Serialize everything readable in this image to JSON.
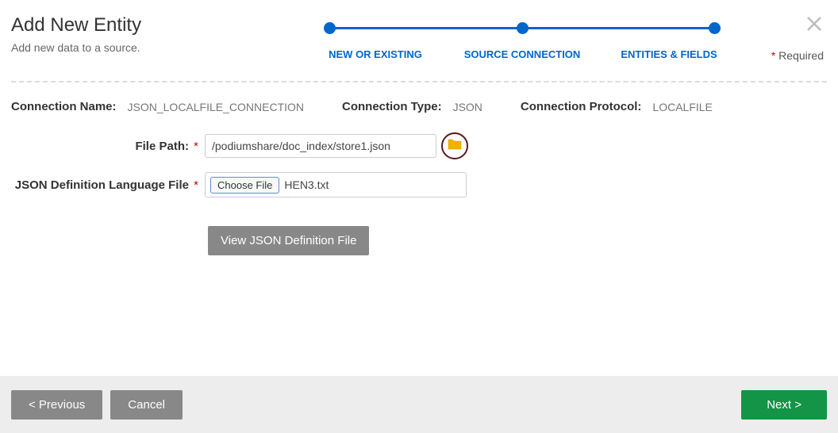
{
  "header": {
    "title": "Add New Entity",
    "subtitle": "Add new data to a source.",
    "required_label": "Required"
  },
  "steps": {
    "s1": "NEW OR EXISTING",
    "s2": "SOURCE CONNECTION",
    "s3": "ENTITIES & FIELDS"
  },
  "connection": {
    "name_label": "Connection Name:",
    "name_value": "JSON_LOCALFILE_CONNECTION",
    "type_label": "Connection Type:",
    "type_value": "JSON",
    "protocol_label": "Connection Protocol:",
    "protocol_value": "LOCALFILE"
  },
  "form": {
    "file_path_label": "File Path:",
    "file_path_value": "/podiumshare/doc_index/store1.json",
    "json_def_label": "JSON Definition Language File",
    "choose_file_label": "Choose File",
    "chosen_file_name": "HEN3.txt",
    "view_btn": "View JSON Definition File"
  },
  "footer": {
    "previous": "< Previous",
    "cancel": "Cancel",
    "next": "Next >"
  }
}
